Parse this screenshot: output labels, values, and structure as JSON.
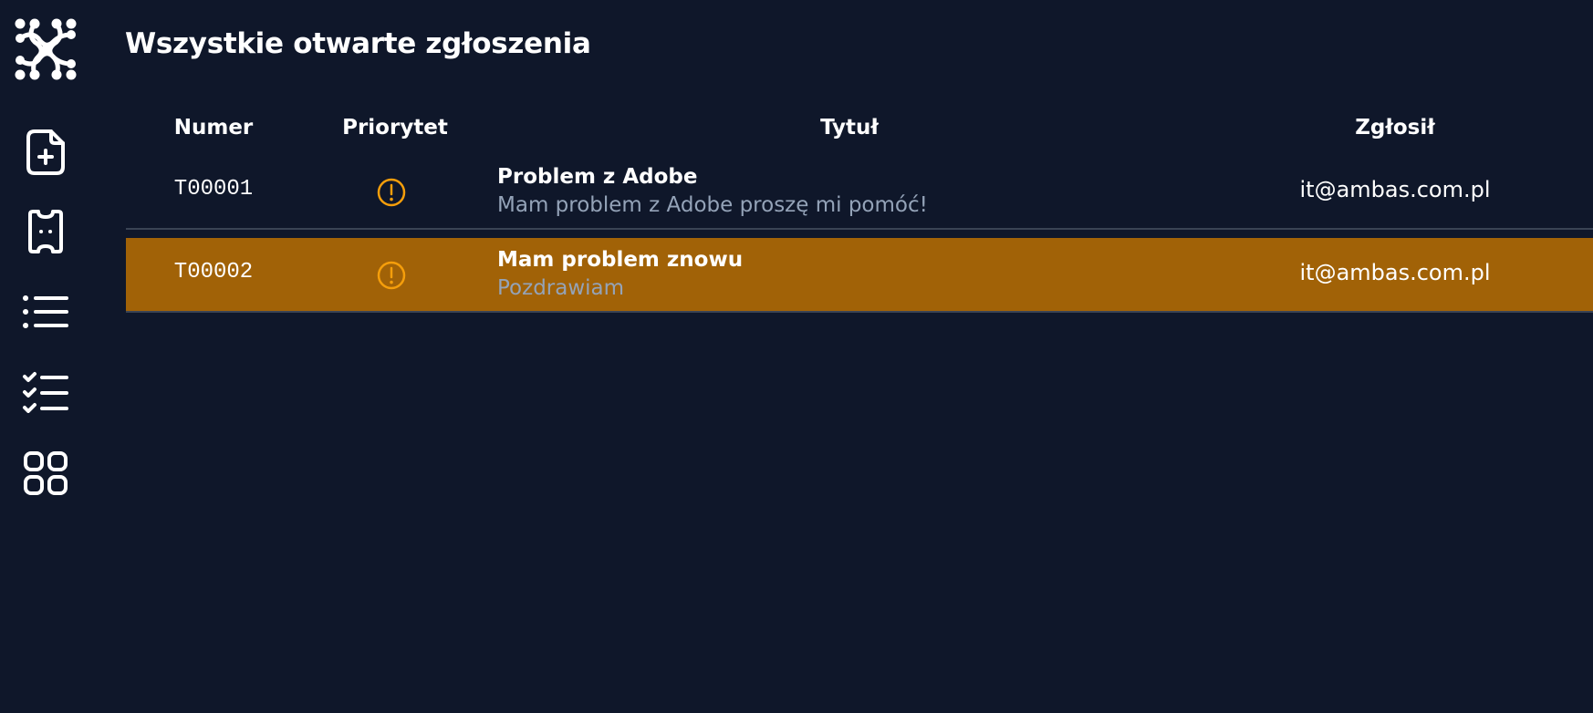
{
  "page": {
    "title": "Wszystkie otwarte zgłoszenia"
  },
  "sidebar": {
    "logo": "network-logo",
    "items": [
      {
        "icon": "file-plus-icon",
        "name": "new-ticket"
      },
      {
        "icon": "ticket-icon",
        "name": "tickets"
      },
      {
        "icon": "list-icon",
        "name": "all-tickets"
      },
      {
        "icon": "checklist-icon",
        "name": "tasks"
      },
      {
        "icon": "grid-icon",
        "name": "dashboard"
      }
    ]
  },
  "table": {
    "headers": {
      "number": "Numer",
      "priority": "Priorytet",
      "title": "Tytuł",
      "reporter": "Zgłosił"
    },
    "rows": [
      {
        "number": "T00001",
        "priority_icon": "alert-circle-icon",
        "title": "Problem z Adobe",
        "description": "Mam problem z Adobe proszę mi pomóć!",
        "reporter": "it@ambas.com.pl",
        "highlighted": false
      },
      {
        "number": "T00002",
        "priority_icon": "alert-circle-icon",
        "title": "Mam problem znowu",
        "description": "Pozdrawiam",
        "reporter": "it@ambas.com.pl",
        "highlighted": true
      }
    ]
  },
  "colors": {
    "background": "#0f172a",
    "row_highlight": "#a16207",
    "priority_icon": "#f59e0b",
    "muted_text": "#94a3b8",
    "divider": "#3a4354"
  }
}
